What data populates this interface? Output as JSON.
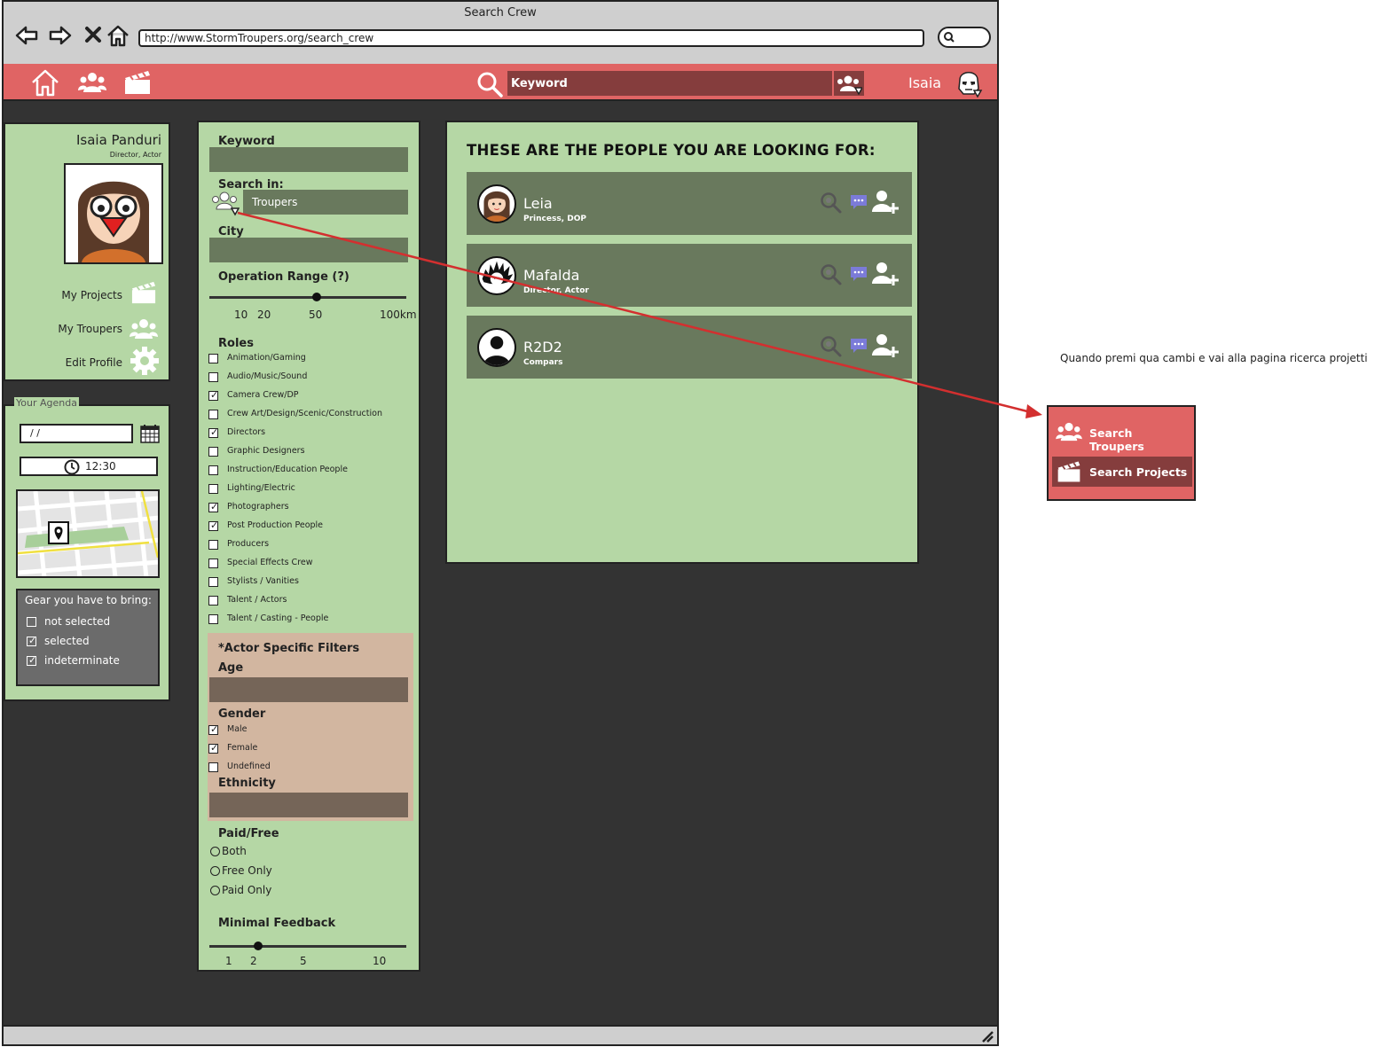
{
  "window_title": "Search Crew",
  "url": "http://www.StormTroupers.org/search_crew",
  "topbar": {
    "search_placeholder": "Keyword",
    "user_name": "Isaia"
  },
  "profile": {
    "name": "Isaia Panduri",
    "roles": "Director,  Actor",
    "links": {
      "projects": "My Projects",
      "troupers": "My Troupers",
      "edit": "Edit Profile"
    }
  },
  "agenda": {
    "title": "Your Agenda",
    "date_value": " /  /",
    "time_value": "12:30",
    "gear_title": "Gear you have to bring:",
    "gear_items": [
      {
        "label": "not selected",
        "checked": false
      },
      {
        "label": "selected",
        "checked": true
      },
      {
        "label": "indeterminate",
        "checked": true
      }
    ]
  },
  "filters": {
    "keyword_label": "Keyword",
    "search_in_label": "Search in:",
    "search_in_value": "Troupers",
    "city_label": "City",
    "range_label": "Operation Range (?)",
    "range_ticks": [
      "10",
      "20",
      "50",
      "100km"
    ],
    "range_value": 50,
    "roles_label": "Roles",
    "roles": [
      {
        "label": "Animation/Gaming",
        "checked": false
      },
      {
        "label": "Audio/Music/Sound",
        "checked": false
      },
      {
        "label": "Camera Crew/DP",
        "checked": true
      },
      {
        "label": "Crew Art/Design/Scenic/Construction",
        "checked": false
      },
      {
        "label": "Directors",
        "checked": true
      },
      {
        "label": "Graphic Designers",
        "checked": false
      },
      {
        "label": "Instruction/Education People",
        "checked": false
      },
      {
        "label": "Lighting/Electric",
        "checked": false
      },
      {
        "label": "Photographers",
        "checked": true
      },
      {
        "label": "Post Production People",
        "checked": true
      },
      {
        "label": "Producers",
        "checked": false
      },
      {
        "label": "Special Effects Crew",
        "checked": false
      },
      {
        "label": "Stylists / Vanities",
        "checked": false
      },
      {
        "label": "Talent / Actors",
        "checked": false
      },
      {
        "label": "Talent / Casting - People",
        "checked": false
      }
    ],
    "actor_title": "*Actor Specific Filters",
    "age_label": "Age",
    "gender_label": "Gender",
    "genders": [
      {
        "label": "Male",
        "checked": true
      },
      {
        "label": "Female",
        "checked": true
      },
      {
        "label": "Undefined",
        "checked": false
      }
    ],
    "ethnicity_label": "Ethnicity",
    "paid_label": "Paid/Free",
    "paid_options": [
      "Both",
      "Free Only",
      "Paid Only"
    ],
    "feedback_label": "Minimal Feedback",
    "feedback_ticks": [
      "1",
      "2",
      "5",
      "10"
    ],
    "feedback_value": 2
  },
  "results": {
    "heading": "THESE ARE THE PEOPLE YOU ARE LOOKING FOR:",
    "people": [
      {
        "name": "Leia",
        "sub": "Princess, DOP"
      },
      {
        "name": "Mafalda",
        "sub": "Director,  Actor"
      },
      {
        "name": "R2D2",
        "sub": "Compars"
      }
    ]
  },
  "annotation": {
    "note": "Quando premi qua cambi e vai alla pagina ricerca projetti",
    "menu": [
      "Search Troupers",
      "Search Projects"
    ]
  },
  "colors": {
    "accent": "#e06464",
    "panel": "#b5d7a5",
    "card": "#69795d",
    "dark": "#333333",
    "arrow": "#d32f2f"
  }
}
